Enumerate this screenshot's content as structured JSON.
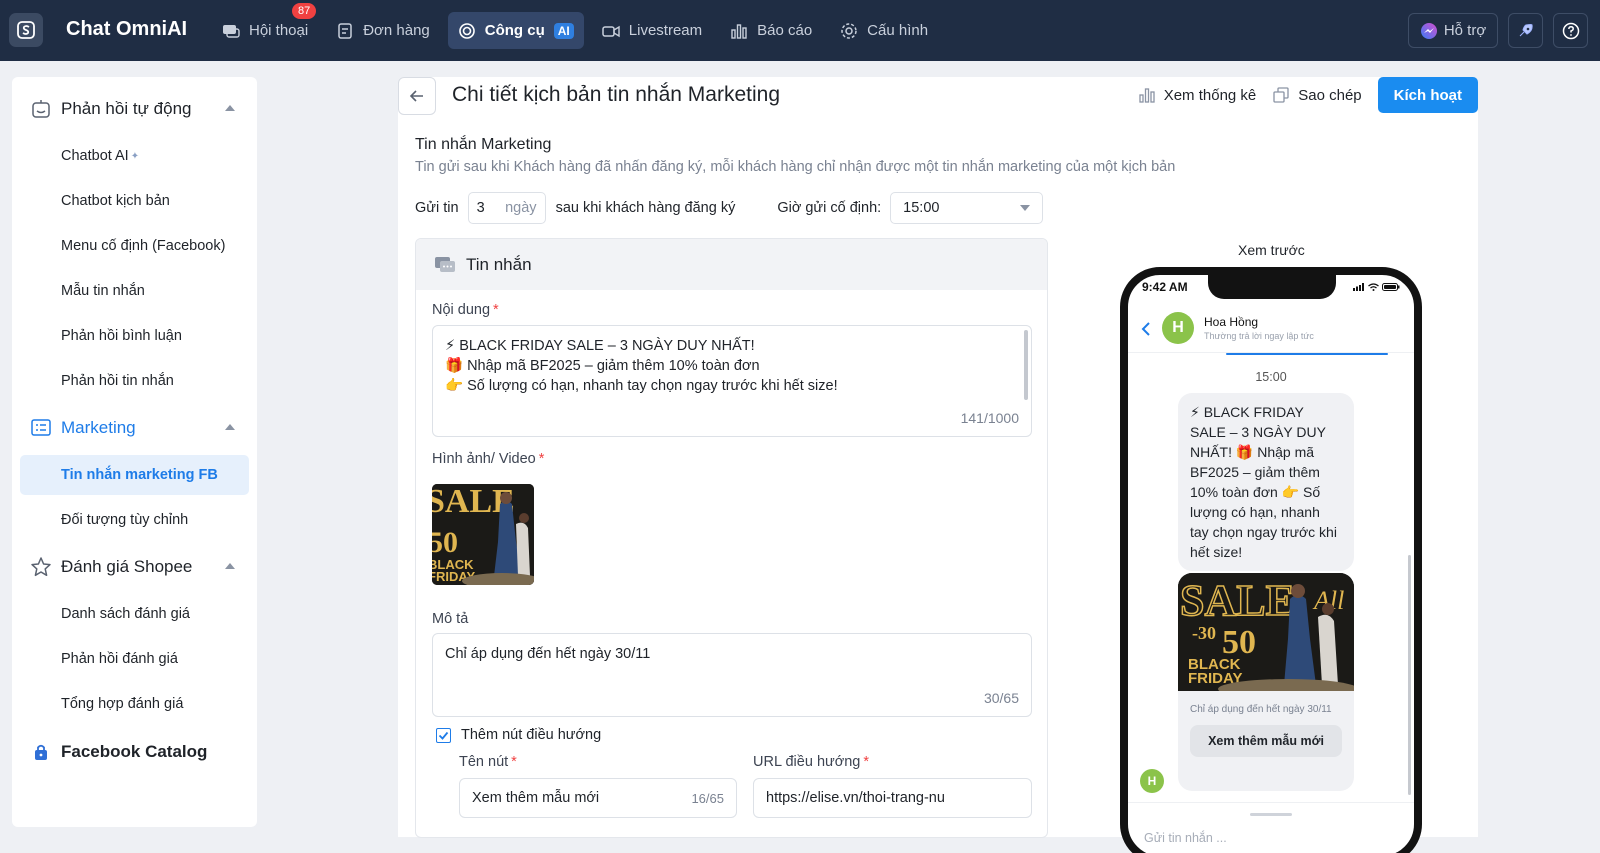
{
  "app": {
    "title": "Chat OmniAI"
  },
  "nav": {
    "conversations": {
      "label": "Hội thoại",
      "badge": "87"
    },
    "orders": {
      "label": "Đơn hàng"
    },
    "ai_tools": {
      "label": "Công cụ",
      "chip": "AI"
    },
    "livestream": {
      "label": "Livestream"
    },
    "reports": {
      "label": "Báo cáo"
    },
    "settings": {
      "label": "Cấu hình"
    }
  },
  "top_right": {
    "support_label": "Hỗ trợ"
  },
  "sidebar": {
    "auto_reply": {
      "label": "Phản hồi tự động",
      "items": [
        "Chatbot AI",
        "Chatbot kịch bản",
        "Menu cố định (Facebook)",
        "Mẫu tin nhắn",
        "Phản hồi bình luận",
        "Phản hồi tin nhắn"
      ]
    },
    "marketing": {
      "label": "Marketing",
      "items": [
        "Tin nhắn marketing FB",
        "Đối tượng tùy chỉnh"
      ]
    },
    "shopee": {
      "label": "Đánh giá Shopee",
      "items": [
        "Danh sách đánh giá",
        "Phản hồi đánh giá",
        "Tổng hợp đánh giá"
      ]
    },
    "facebook_catalog": {
      "label": "Facebook Catalog"
    }
  },
  "header": {
    "title": "Chi tiết kịch bản tin nhắn Marketing",
    "stats_label": "Xem thống kê",
    "copy_label": "Sao chép",
    "activate_label": "Kích hoạt"
  },
  "section": {
    "title": "Tin nhắn Marketing",
    "description": "Tin gửi sau khi Khách hàng đã nhấn đăng ký, mỗi khách hàng chỉ nhận được một tin nhắn marketing của một kịch bản"
  },
  "schedule": {
    "send_label": "Gửi tin",
    "days_value": "3",
    "days_unit": "ngày",
    "after_label": "sau khi khách hàng đăng ký",
    "fixed_time_label": "Giờ gửi cố định:",
    "time_value": "15:00"
  },
  "message": {
    "panel_title": "Tin nhắn",
    "content_label": "Nội dung",
    "content_lines": [
      "⚡ BLACK FRIDAY SALE – 3 NGÀY DUY NHẤT!",
      "🎁 Nhập mã BF2025 – giảm thêm 10% toàn đơn",
      "👉 Số lượng có hạn, nhanh tay chọn ngay trước khi hết size!"
    ],
    "content_counter": "141/1000",
    "media_label": "Hình ảnh/ Video",
    "description_label": "Mô tả",
    "description_value": "Chỉ áp dụng đến hết ngày 30/11",
    "description_counter": "30/65",
    "nav_button_checkbox_label": "Thêm nút điều hướng",
    "nav_button_checked": true,
    "button_name_label": "Tên nút",
    "button_name_value": "Xem thêm mẫu mới",
    "button_name_counter": "16/65",
    "url_label": "URL điều hướng",
    "url_value": "https://elise.vn/thoi-trang-nu"
  },
  "preview": {
    "label": "Xem trước",
    "status_time": "9:42 AM",
    "contact_name": "Hoa Hồng",
    "contact_status": "Thường trả lời ngay lập tức",
    "avatar_letter": "H",
    "message_time": "15:00",
    "bubble_text": "⚡ BLACK FRIDAY SALE – 3 NGÀY DUY NHẤT! 🎁 Nhập mã BF2025 – giảm thêm 10% toàn đơn 👉 Số lượng có hạn, nhanh tay chọn ngay trước khi hết size!",
    "card_description": "Chỉ áp dụng đến hết ngày 30/11",
    "card_button": "Xem thêm mẫu mới",
    "input_placeholder": "Gửi tin nhắn ..."
  },
  "promo_image": {
    "headline": "SALE",
    "script": "All",
    "discount_low": "-30",
    "discount_high": "50",
    "line1": "BLACK",
    "line2": "FRIDAY"
  },
  "colors": {
    "accent": "#1a8cf0",
    "topbar": "#1f2d44",
    "badge": "#f04141"
  }
}
